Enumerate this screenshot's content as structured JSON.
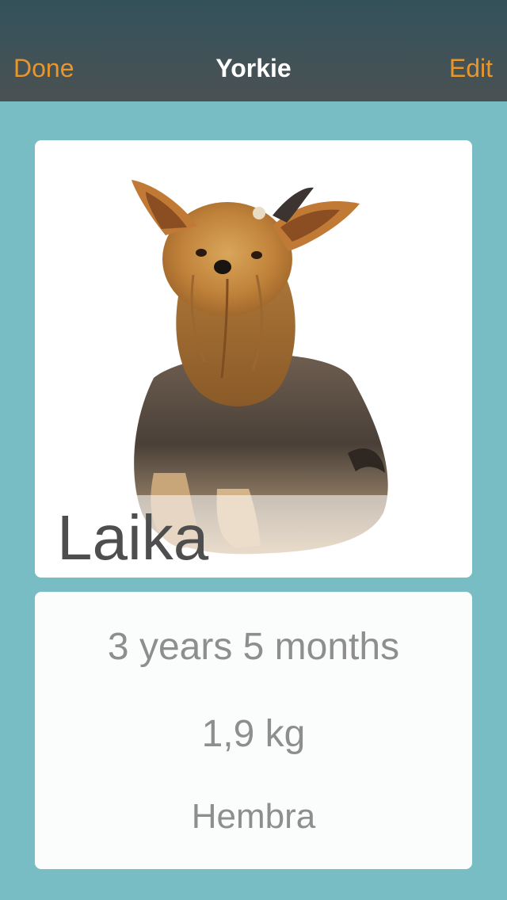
{
  "navbar": {
    "left_button": "Done",
    "title": "Yorkie",
    "right_button": "Edit"
  },
  "pet": {
    "name": "Laika",
    "photo_icon": "yorkshire-terrier-dog-photo",
    "age": "3 years 5 months",
    "weight": "1,9 kg",
    "sex": "Hembra"
  },
  "colors": {
    "background": "#78bcc4",
    "navbar": "#3e5259",
    "accent": "#e7962c",
    "title": "#ffffff",
    "name_text": "#4e4e4e",
    "info_text": "#8e8e8e"
  }
}
